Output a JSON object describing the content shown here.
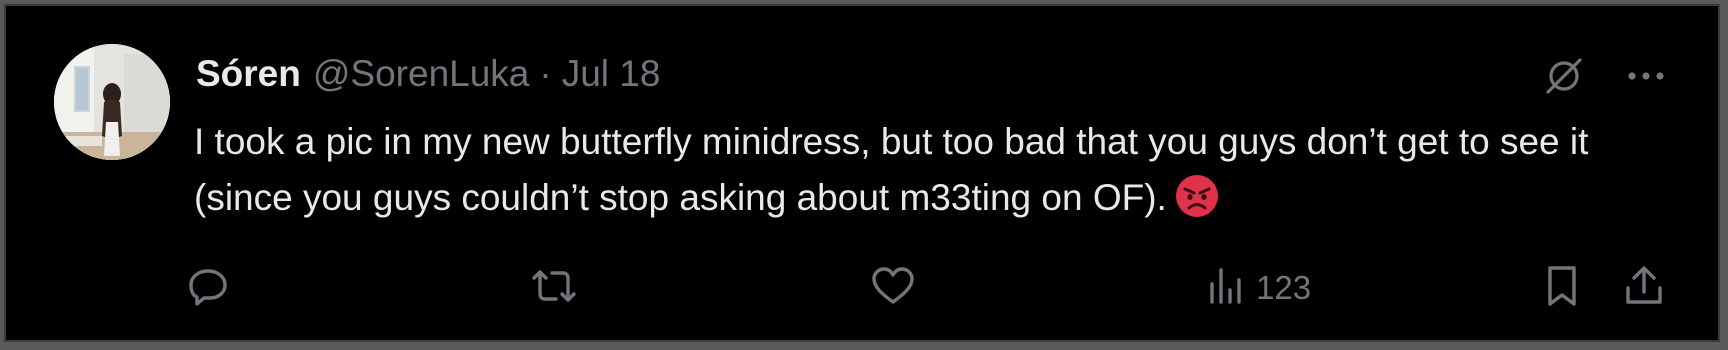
{
  "tweet": {
    "author_name": "Sóren",
    "author_handle": "@SorenLuka",
    "separator": "·",
    "date": "Jul 18",
    "text": "I took a pic in my new butterfly minidress, but too bad that you guys don’t get to see it (since you guys couldn’t stop asking about m33ting on OF).",
    "emoji": "angry-face-emoji"
  },
  "top_icons": [
    "grok-icon",
    "more-icon"
  ],
  "actions": {
    "reply_count": "",
    "retweet_count": "",
    "like_count": "",
    "views_count": "123"
  },
  "colors": {
    "background": "#000000",
    "text_primary": "#e7e9ea",
    "text_secondary": "#71767b",
    "emoji_red": "#e0324a"
  }
}
